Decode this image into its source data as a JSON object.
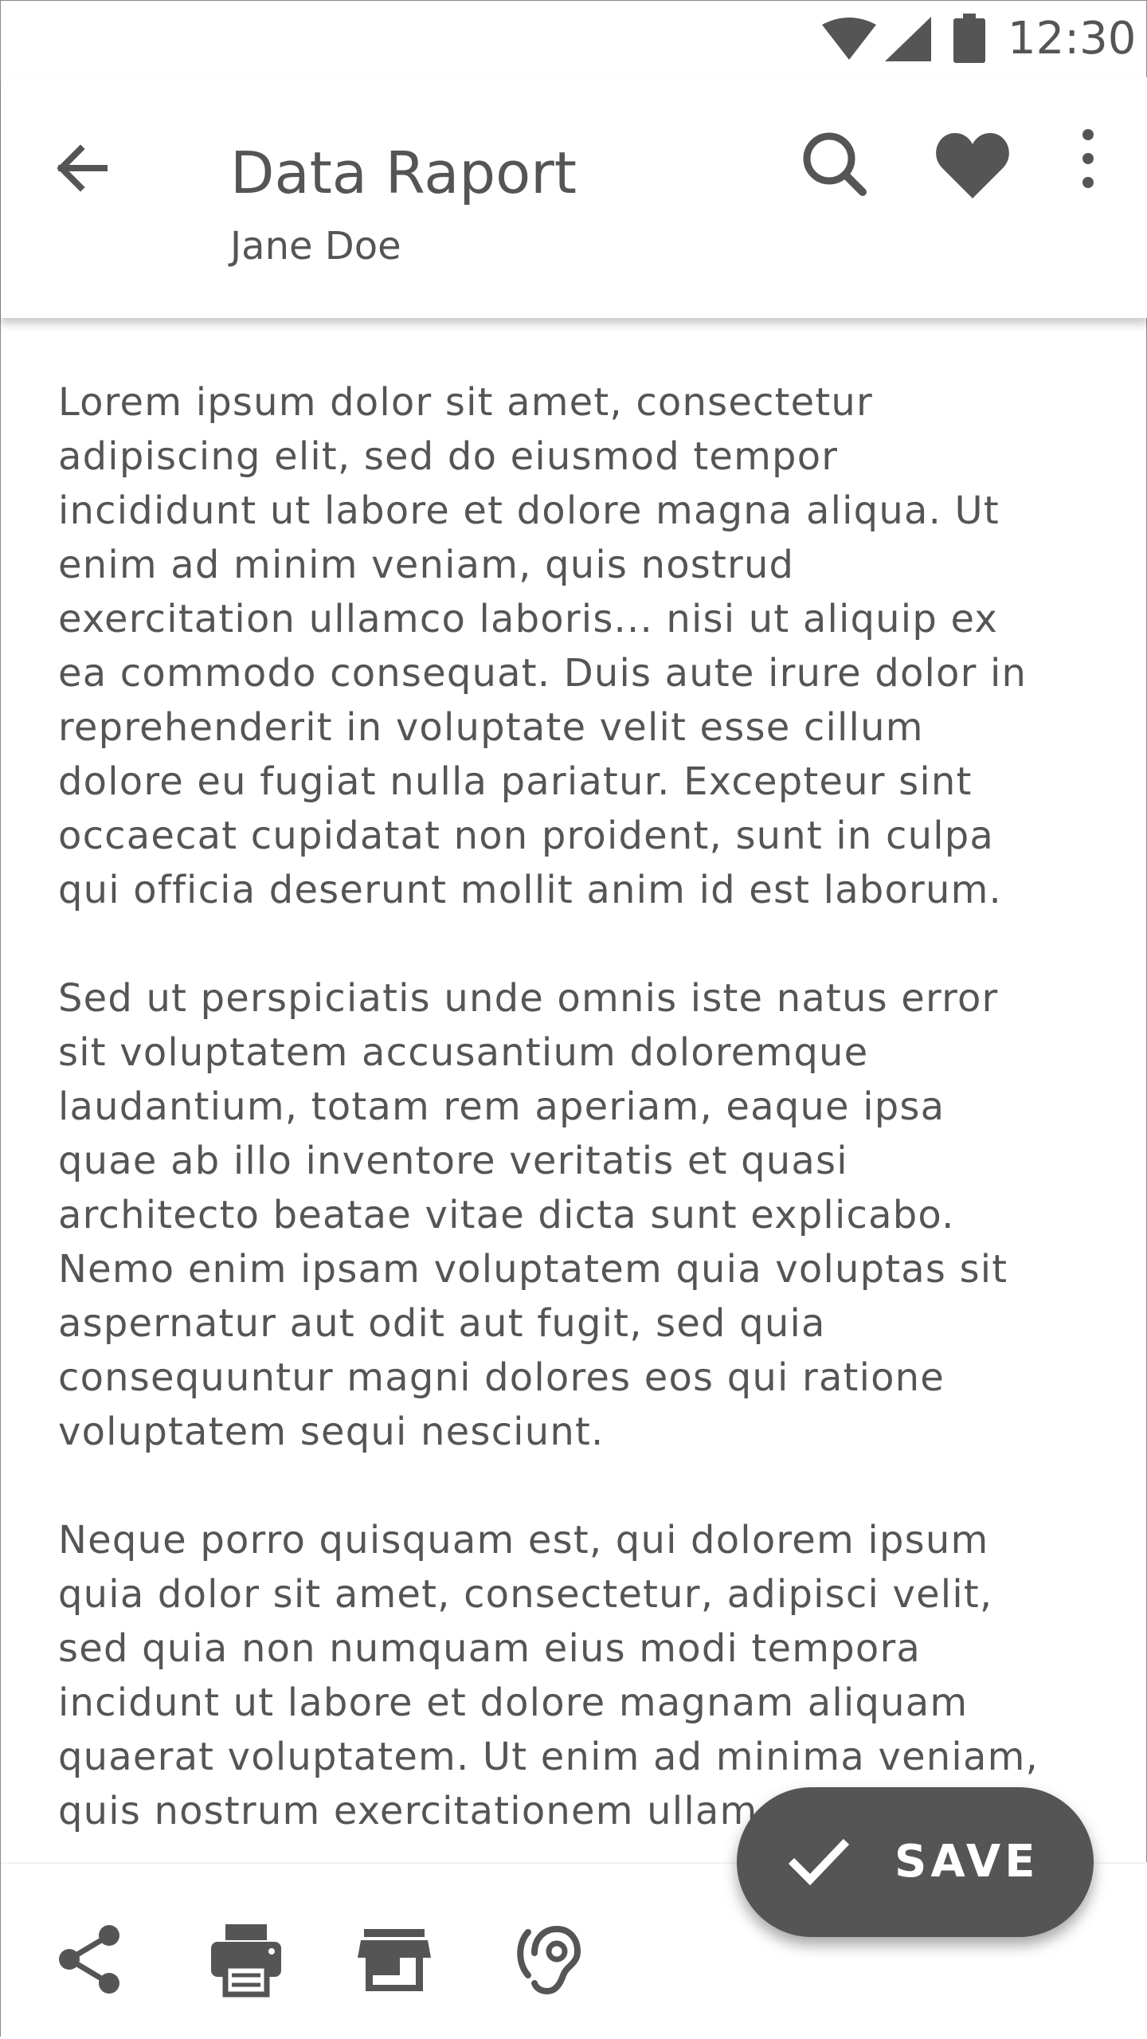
{
  "status_bar": {
    "time": "12:30",
    "icons": [
      "wifi-icon",
      "signal-icon",
      "battery-icon"
    ]
  },
  "app_bar": {
    "title": "Data Raport",
    "subtitle": "Jane Doe",
    "actions": [
      "back-arrow-icon",
      "search-icon",
      "heart-icon",
      "more-vertical-icon"
    ]
  },
  "content": {
    "paragraphs": [
      "Lorem ipsum dolor sit amet, consectetur\nadipiscing elit, sed do eiusmod tempor\nincididunt ut labore et dolore magna aliqua. Ut\nenim ad minim veniam, quis nostrud\nexercitation ullamco laboris... nisi ut aliquip ex\nea commodo consequat. Duis aute irure dolor in\nreprehenderit in voluptate velit esse cillum\ndolore eu fugiat nulla pariatur. Excepteur sint\noccaecat cupidatat non proident, sunt in culpa\nqui officia deserunt mollit anim id est laborum.",
      "Sed ut perspiciatis unde omnis iste natus error\nsit voluptatem accusantium doloremque\nlaudantium, totam rem aperiam, eaque ipsa\nquae ab illo inventore veritatis et quasi\narchitecto beatae vitae dicta sunt explicabo.\nNemo enim ipsam voluptatem quia voluptas sit\naspernatur aut odit aut fugit, sed quia\nconsequuntur magni dolores eos qui ratione\nvoluptatem sequi nesciunt.",
      "Neque porro quisquam est, qui dolorem ipsum\nquia dolor sit amet, consectetur, adipisci velit,\nsed quia non numquam eius modi tempora\nincidunt ut labore et dolore magnam aliquam\nquaerat voluptatem. Ut enim ad minima veniam,\nquis nostrum exercitationem ullam"
    ]
  },
  "fab": {
    "label": "SAVE",
    "icon": "check-icon"
  },
  "bottom_bar": {
    "icons": [
      "share-icon",
      "print-icon",
      "store-icon",
      "hearing-icon"
    ]
  },
  "colors": {
    "icon": "#555555",
    "text": "#555555",
    "fab_background": "#555555",
    "fab_text": "#ffffff",
    "background": "#ffffff"
  }
}
